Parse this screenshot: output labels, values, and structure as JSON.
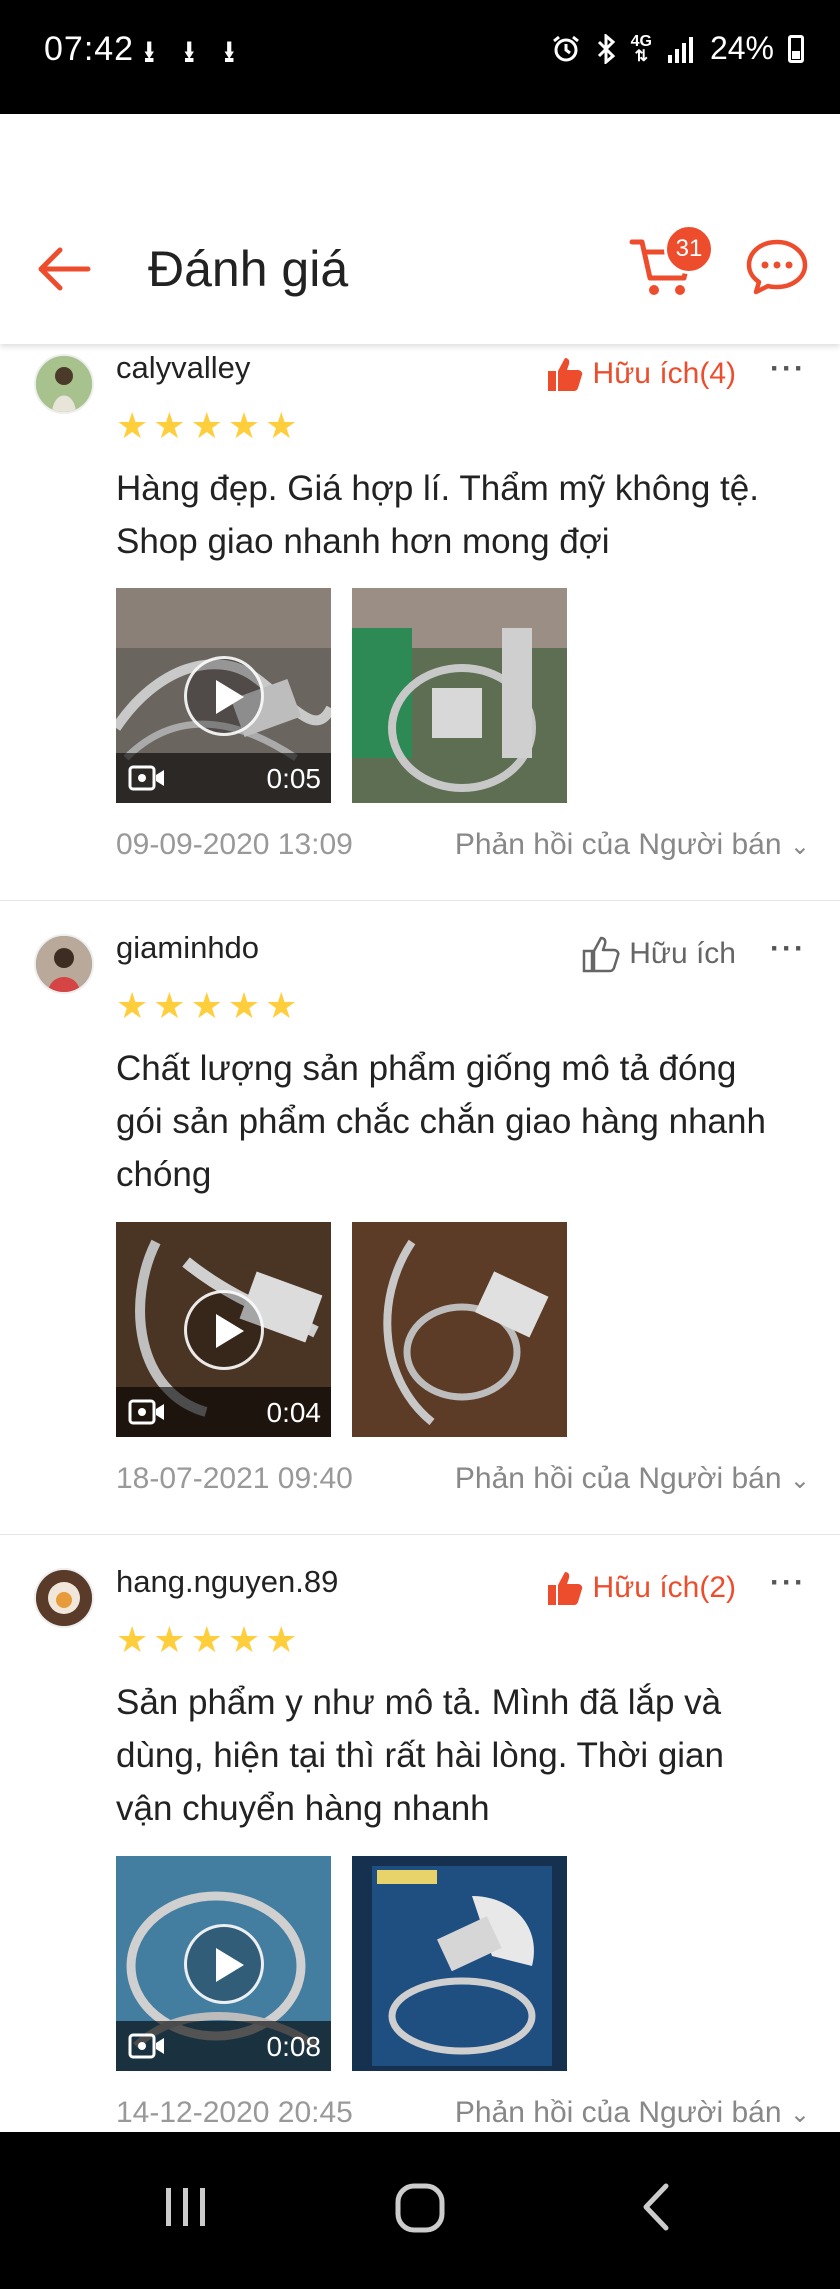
{
  "status_bar": {
    "time": "07:42",
    "network": "4G",
    "battery": "24%"
  },
  "header": {
    "title": "Đánh giá",
    "cart_count": "31"
  },
  "reviews": [
    {
      "username": "calyvalley",
      "helpful_label": "Hữu ích(4)",
      "helpful_active": true,
      "rating": 5,
      "text_lines": [
        "Hàng đẹp. Giá hợp lí. Thẩm mỹ không tệ.",
        "Shop giao nhanh hơn mong đợi"
      ],
      "video_duration": "0:05",
      "date": "09-09-2020 13:09",
      "reply_label": "Phản hồi của Người bán"
    },
    {
      "username": "giaminhdo",
      "helpful_label": "Hữu ích",
      "helpful_active": false,
      "rating": 5,
      "text_lines": [
        "Chất lượng sản phẩm giống mô tả đóng",
        "gói sản phẩm chắc chắn giao hàng nhanh",
        "chóng"
      ],
      "video_duration": "0:04",
      "date": "18-07-2021 09:40",
      "reply_label": "Phản hồi của Người bán"
    },
    {
      "username": "hang.nguyen.89",
      "helpful_label": "Hữu ích(2)",
      "helpful_active": true,
      "rating": 5,
      "text_lines": [
        "Sản phẩm y như mô tả. Mình đã lắp và",
        "dùng, hiện tại thì rất hài lòng. Thời gian",
        "vận chuyển hàng nhanh"
      ],
      "video_duration": "0:08",
      "date": "14-12-2020 20:45",
      "reply_label": "Phản hồi của Người bán"
    }
  ],
  "colors": {
    "accent": "#ee4d2d",
    "star": "#ffce3d"
  }
}
